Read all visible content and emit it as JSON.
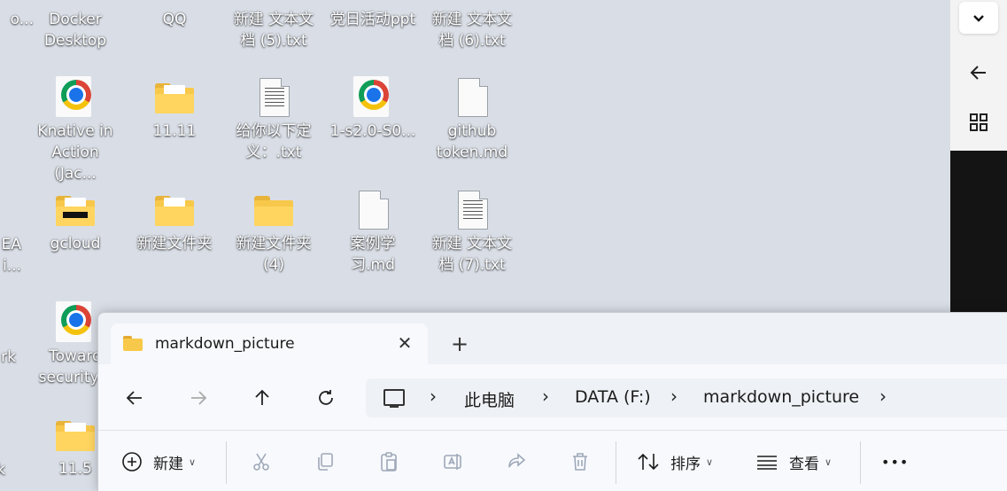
{
  "desktop": {
    "icons": [
      {
        "label": "Docker\nDesktop",
        "type": "docker-icon"
      },
      {
        "label": "QQ",
        "type": "qq-icon"
      },
      {
        "label": "新建 文本文\n档 (5).txt",
        "type": "text-file-icon"
      },
      {
        "label": "党日活动ppt",
        "type": "chrome-icon"
      },
      {
        "label": "新建 文本文\n档 (6).txt",
        "type": "text-file-icon"
      },
      {
        "label": "Knative in\nAction (Jac...",
        "type": "chrome-icon"
      },
      {
        "label": "11.11",
        "type": "folder-icon"
      },
      {
        "label": "给你以下定\n义：.txt",
        "type": "text-file-icon"
      },
      {
        "label": "1-s2.0-S0...",
        "type": "chrome-icon"
      },
      {
        "label": "github\ntoken.md",
        "type": "markdown-file-icon"
      },
      {
        "label": "gcloud",
        "type": "folder-icon"
      },
      {
        "label": "新建文件夹",
        "type": "folder-icon"
      },
      {
        "label": "新建文件夹\n(4)",
        "type": "folder-icon"
      },
      {
        "label": "案例学习.md",
        "type": "markdown-file-icon"
      },
      {
        "label": "新建 文本文\n档 (7).txt",
        "type": "text-file-icon"
      },
      {
        "label": "Toward\nsecurity c",
        "type": "chrome-icon"
      },
      {
        "label": "11.5",
        "type": "folder-icon"
      }
    ],
    "edge_labels": [
      "o...",
      "EA\ni...",
      "rk",
      "k"
    ]
  },
  "side_panel": {
    "collapse_icon": "chevron-down-icon",
    "back_icon": "arrow-left-icon",
    "apps_icon": "grid-icon"
  },
  "explorer": {
    "tab_title": "markdown_picture",
    "breadcrumb": [
      "此电脑",
      "DATA (F:)",
      "markdown_picture"
    ],
    "toolbar": {
      "new_label": "新建",
      "sort_label": "排序",
      "view_label": "查看",
      "more_label": "•••"
    }
  },
  "colors": {
    "desktop_bg": "#d9dee6",
    "folder": "#f8c84a",
    "disabled": "#9ea8b8"
  }
}
